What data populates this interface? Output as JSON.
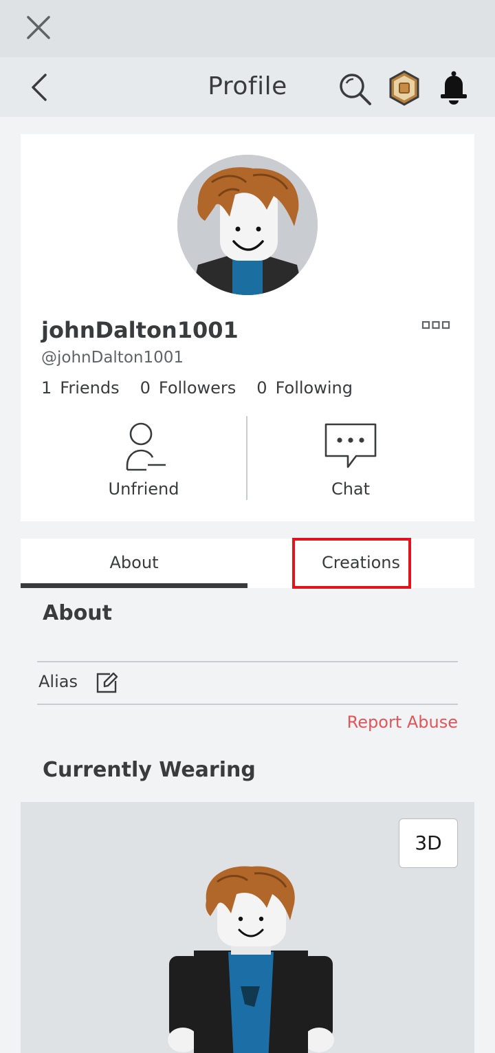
{
  "topbar": {
    "close_icon": "close-icon"
  },
  "header": {
    "title": "Profile",
    "icons": [
      "back-chevron-icon",
      "search-icon",
      "robux-icon",
      "bell-icon"
    ]
  },
  "profile": {
    "display_name": "johnDalton1001",
    "username": "@johnDalton1001",
    "stats": [
      {
        "count": "1",
        "label": "Friends"
      },
      {
        "count": "0",
        "label": "Followers"
      },
      {
        "count": "0",
        "label": "Following"
      }
    ],
    "actions": {
      "unfriend_label": "Unfriend",
      "chat_label": "Chat"
    }
  },
  "tabs": {
    "active": "About",
    "items": [
      "About",
      "Creations"
    ]
  },
  "about": {
    "title": "About",
    "alias_label": "Alias",
    "report_label": "Report Abuse"
  },
  "wearing": {
    "title": "Currently Wearing",
    "view_3d_label": "3D"
  },
  "colors": {
    "highlight": "#e3131b",
    "report": "#e0565a",
    "text": "#393b3d"
  }
}
